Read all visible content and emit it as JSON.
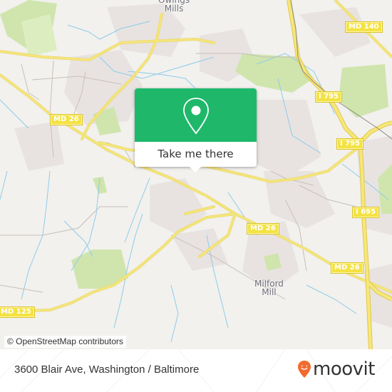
{
  "map": {
    "attribution": "© OpenStreetMap contributors",
    "places": [
      {
        "name": "owings-mills",
        "label_line1": "Owings",
        "label_line2": "Mills"
      },
      {
        "name": "milford-mill",
        "label_line1": "Milford",
        "label_line2": "Mill"
      }
    ],
    "shields": [
      {
        "name": "md-140",
        "label": "MD 140"
      },
      {
        "name": "md-26-west",
        "label": "MD 26"
      },
      {
        "name": "i-795-north",
        "label": "I 795"
      },
      {
        "name": "i-795-south",
        "label": "I 795"
      },
      {
        "name": "i-695",
        "label": "I 695"
      },
      {
        "name": "md-26-center",
        "label": "MD 26"
      },
      {
        "name": "md-26-east",
        "label": "MD 26"
      },
      {
        "name": "md-125",
        "label": "MD 125"
      }
    ],
    "colors": {
      "background": "#f2f1ee",
      "road_major": "#f4e57a",
      "water": "#8ecbe9",
      "park": "#cfe5ad",
      "urban": "#e8e3e1"
    }
  },
  "popup": {
    "icon": "map-pin-icon",
    "button_label": "Take me there",
    "color": "#1fb86b"
  },
  "footer": {
    "address": "3600 Blair Ave, Washington / Baltimore",
    "brand": "moovit",
    "brand_icon": "moovit-smile-pin-icon",
    "brand_color": "#f26a2e"
  }
}
